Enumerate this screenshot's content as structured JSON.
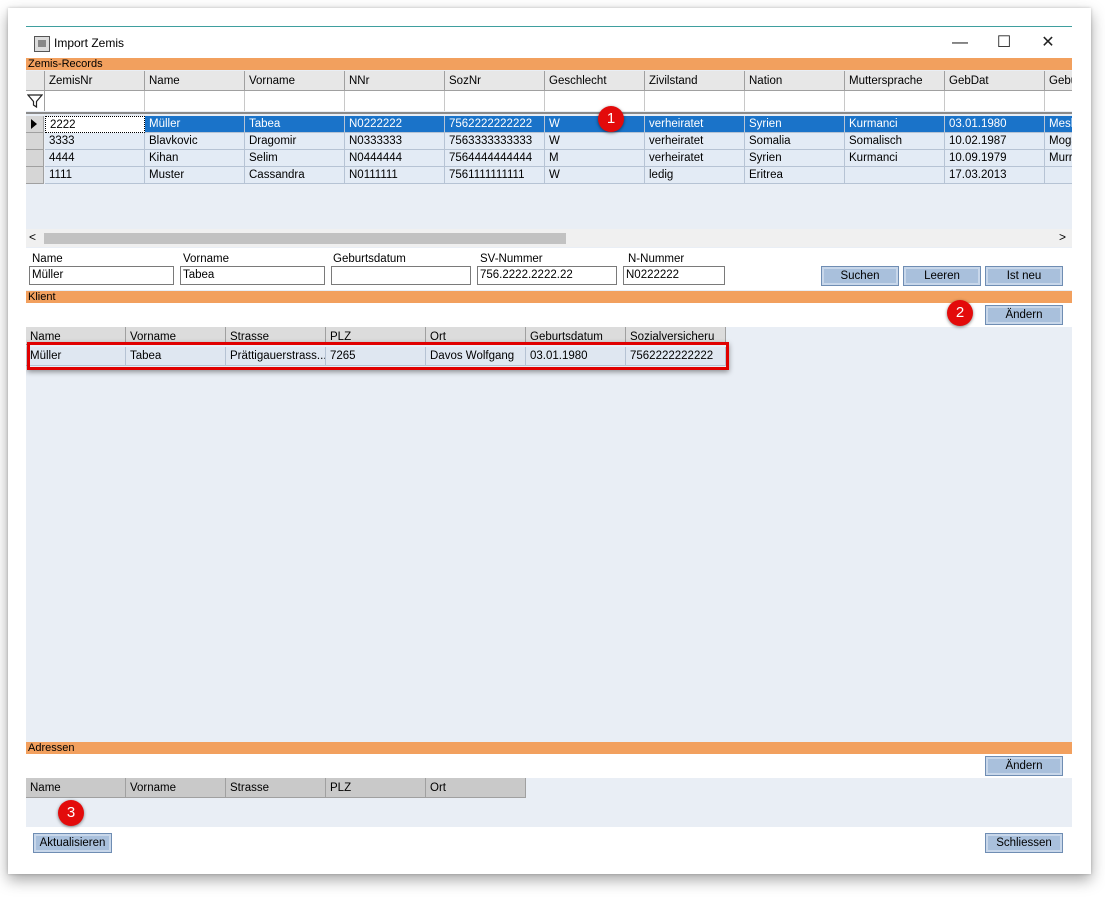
{
  "window": {
    "title": "Import Zemis",
    "minimize": "—",
    "maximize": "☐",
    "close": "✕"
  },
  "zemis": {
    "section_label": "Zemis-Records",
    "columns": [
      "ZemisNr",
      "Name",
      "Vorname",
      "NNr",
      "SozNr",
      "Geschlecht",
      "Zivilstand",
      "Nation",
      "Muttersprache",
      "GebDat",
      "Gebu"
    ],
    "rows": [
      [
        "2222",
        "Müller",
        "Tabea",
        "N0222222",
        "7562222222222",
        "W",
        "verheiratet",
        "Syrien",
        "Kurmanci",
        "03.01.1980",
        "Mesk"
      ],
      [
        "3333",
        "Blavkovic",
        "Dragomir",
        "N0333333",
        "7563333333333",
        "W",
        "verheiratet",
        "Somalia",
        "Somalisch",
        "10.02.1987",
        "Moga"
      ],
      [
        "4444",
        "Kihan",
        "Selim",
        "N0444444",
        "7564444444444",
        "M",
        "verheiratet",
        "Syrien",
        "Kurmanci",
        "10.09.1979",
        "Murra"
      ],
      [
        "1111",
        "Muster",
        "Cassandra",
        "N0111111",
        "7561111111111",
        "W",
        "ledig",
        "Eritrea",
        "",
        "17.03.2013",
        ""
      ]
    ],
    "selected_row": 0,
    "scroll_left": "<",
    "scroll_right": ">"
  },
  "search": {
    "name_label": "Name",
    "name_value": "Müller",
    "vorname_label": "Vorname",
    "vorname_value": "Tabea",
    "geburtsdatum_label": "Geburtsdatum",
    "geburtsdatum_value": "",
    "sv_label": "SV-Nummer",
    "sv_value": "756.2222.2222.22",
    "n_label": "N-Nummer",
    "n_value": "N0222222",
    "suchen": "Suchen",
    "leeren": "Leeren",
    "ist_neu": "Ist neu"
  },
  "klient": {
    "section_label": "Klient",
    "aendern": "Ändern",
    "columns": [
      "Name",
      "Vorname",
      "Strasse",
      "PLZ",
      "Ort",
      "Geburtsdatum",
      "Sozialversicheru"
    ],
    "rows": [
      [
        "Müller",
        "Tabea",
        "Prättigauerstrass...",
        "7265",
        "Davos Wolfgang",
        "03.01.1980",
        "7562222222222"
      ]
    ]
  },
  "adressen": {
    "section_label": "Adressen",
    "aendern": "Ändern",
    "columns": [
      "Name",
      "Vorname",
      "Strasse",
      "PLZ",
      "Ort"
    ]
  },
  "footer": {
    "aktualisieren": "Aktualisieren",
    "schliessen": "Schliessen"
  },
  "markers": [
    "1",
    "2",
    "3"
  ],
  "colors": {
    "accent_orange": "#f2a05e",
    "selection_blue": "#0a6fd4",
    "marker_red": "#e30b0b"
  }
}
